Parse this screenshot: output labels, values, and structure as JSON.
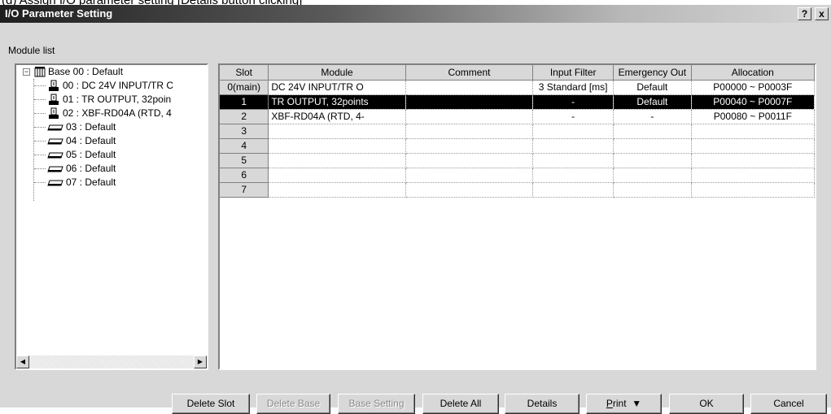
{
  "caption": "(d) Assign I/O parameter setting [Details button clicking]",
  "window": {
    "title": "I/O Parameter Setting",
    "help_button": "?",
    "close_button": "x"
  },
  "module_list_label": "Module list",
  "tree": {
    "root": "Base 00 : Default",
    "items": [
      {
        "label": "00 : DC 24V INPUT/TR C",
        "icon": "module-icon"
      },
      {
        "label": "01 : TR OUTPUT, 32poin",
        "icon": "module-icon"
      },
      {
        "label": "02 :  XBF-RD04A (RTD, 4",
        "icon": "module-icon"
      },
      {
        "label": "03 : Default",
        "icon": "empty-slot-icon"
      },
      {
        "label": "04 : Default",
        "icon": "empty-slot-icon"
      },
      {
        "label": "05 : Default",
        "icon": "empty-slot-icon"
      },
      {
        "label": "06 : Default",
        "icon": "empty-slot-icon"
      },
      {
        "label": "07 : Default",
        "icon": "empty-slot-icon"
      }
    ]
  },
  "grid": {
    "columns": [
      "Slot",
      "Module",
      "Comment",
      "Input Filter",
      "Emergency Out",
      "Allocation"
    ],
    "rows": [
      {
        "slot": "0(main)",
        "module": "DC 24V INPUT/TR O",
        "comment": "",
        "input_filter": "3 Standard [ms]",
        "emergency_out": "Default",
        "allocation": "P00000 ~ P0003F"
      },
      {
        "slot": "1",
        "module": "TR OUTPUT, 32points",
        "comment": "",
        "input_filter": "-",
        "emergency_out": "Default",
        "allocation": "P00040 ~ P0007F"
      },
      {
        "slot": "2",
        "module": "XBF-RD04A (RTD, 4-",
        "comment": "",
        "input_filter": "-",
        "emergency_out": "-",
        "allocation": "P00080 ~ P0011F"
      },
      {
        "slot": "3",
        "module": "",
        "comment": "",
        "input_filter": "",
        "emergency_out": "",
        "allocation": ""
      },
      {
        "slot": "4",
        "module": "",
        "comment": "",
        "input_filter": "",
        "emergency_out": "",
        "allocation": ""
      },
      {
        "slot": "5",
        "module": "",
        "comment": "",
        "input_filter": "",
        "emergency_out": "",
        "allocation": ""
      },
      {
        "slot": "6",
        "module": "",
        "comment": "",
        "input_filter": "",
        "emergency_out": "",
        "allocation": ""
      },
      {
        "slot": "7",
        "module": "",
        "comment": "",
        "input_filter": "",
        "emergency_out": "",
        "allocation": ""
      }
    ]
  },
  "buttons": {
    "delete_slot": "Delete Slot",
    "delete_base": "Delete Base",
    "base_setting": "Base Setting",
    "delete_all": "Delete All",
    "details": "Details",
    "print_first": "P",
    "print_rest": "rint",
    "print_arrow": "▼",
    "ok": "OK",
    "cancel": "Cancel"
  }
}
